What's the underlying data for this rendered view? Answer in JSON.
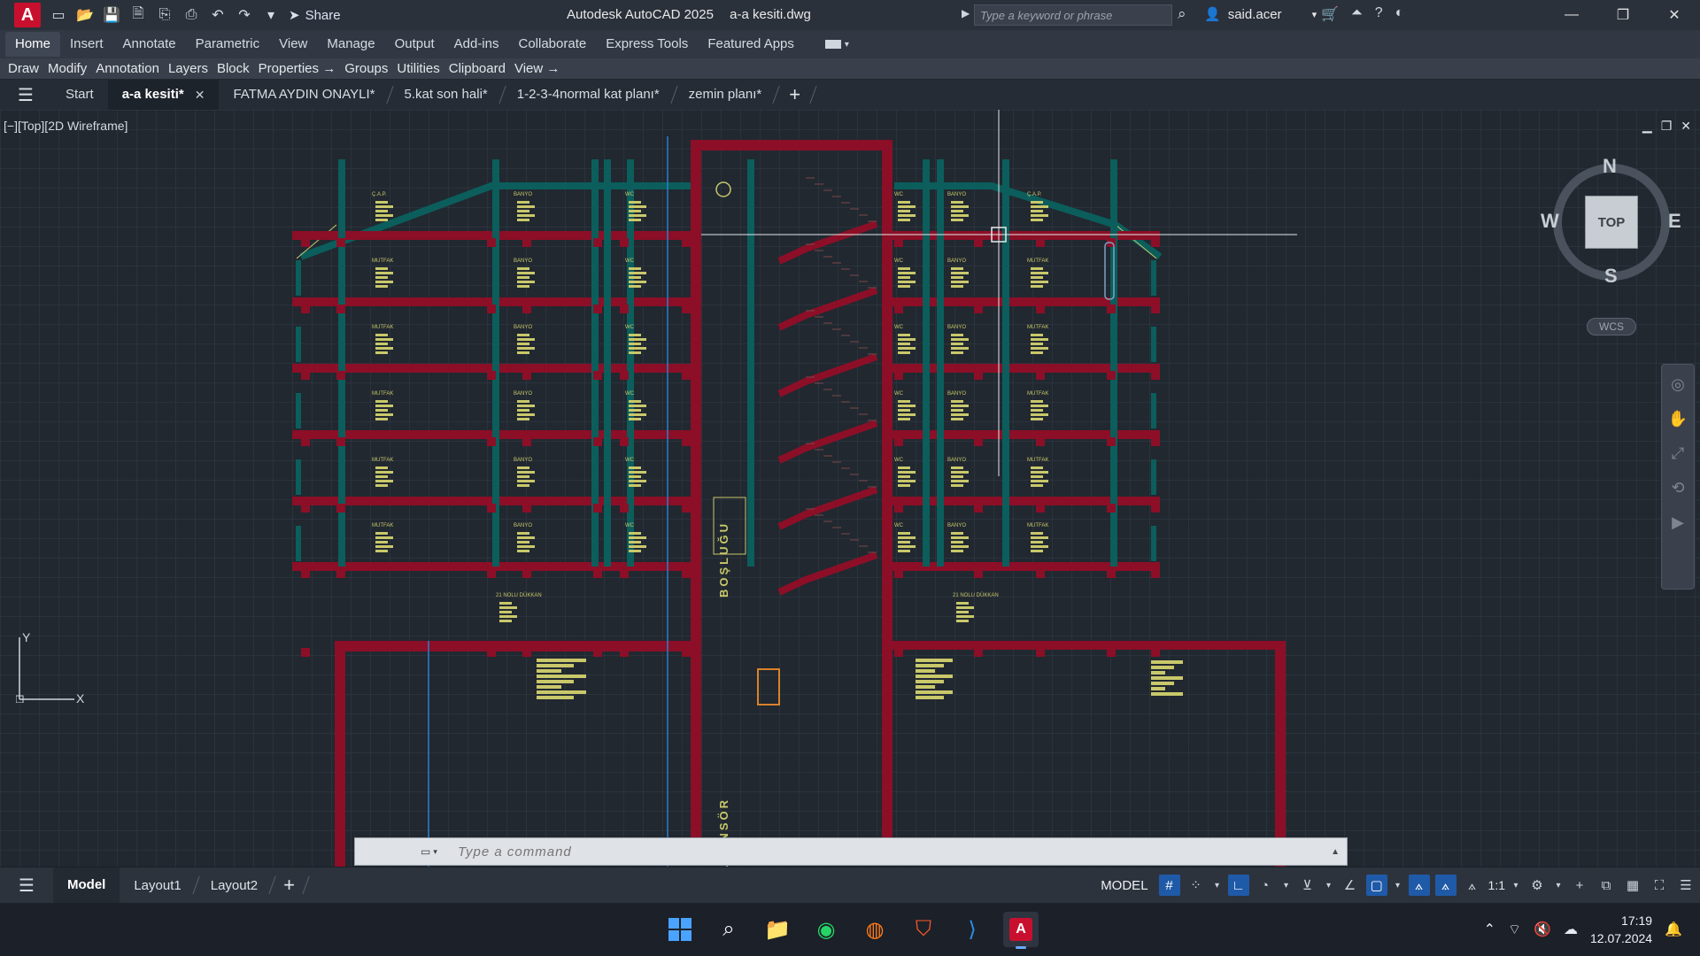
{
  "titlebar": {
    "app_icon_letter": "A",
    "share_label": "Share",
    "app_name": "Autodesk AutoCAD 2025",
    "file_name": "a-a kesiti.dwg",
    "search_placeholder": "Type a keyword or phrase",
    "user_name": "said.acer"
  },
  "ribbon": {
    "tabs": [
      "Home",
      "Insert",
      "Annotate",
      "Parametric",
      "View",
      "Manage",
      "Output",
      "Add-ins",
      "Collaborate",
      "Express Tools",
      "Featured Apps"
    ],
    "panels": [
      "Draw",
      "Modify",
      "Annotation",
      "Layers",
      "Block",
      "Properties →",
      "Groups",
      "Utilities",
      "Clipboard",
      "View →"
    ]
  },
  "file_tabs": {
    "start": "Start",
    "tabs": [
      "a-a kesiti*",
      "FATMA AYDIN ONAYLI*",
      "5.kat son hali*",
      "1-2-3-4normal kat planı*",
      "zemin planı*"
    ],
    "active_index": 0
  },
  "viewport": {
    "view_label": "[−][Top][2D Wireframe]",
    "viewcube": {
      "top": "TOP",
      "north": "N",
      "south": "S",
      "east": "E",
      "west": "W",
      "wcs": "WCS"
    },
    "ucs": {
      "x": "X",
      "y": "Y"
    },
    "drawing": {
      "elevator_label": "ASANSÖR",
      "shaft_label": "BOŞLUĞU",
      "room_labels": [
        "Ç.A.P.",
        "MUTFAK",
        "BANYO",
        "WC",
        "21 NOLU DÜKKAN"
      ],
      "colors": {
        "slab": "#8c0f27",
        "wall": "#0b5e5c",
        "text": "#c9c86a",
        "grid": "#2a323c"
      }
    }
  },
  "command": {
    "placeholder": "Type a command"
  },
  "statusbar": {
    "layouts": [
      "Model",
      "Layout1",
      "Layout2"
    ],
    "model_label": "MODEL",
    "scale": "1:1"
  },
  "taskbar": {
    "apps": [
      "windows-start",
      "search",
      "file-explorer",
      "whatsapp",
      "firefox",
      "brave",
      "vscode",
      "autocad"
    ],
    "time": "17:19",
    "date": "12.07.2024"
  }
}
